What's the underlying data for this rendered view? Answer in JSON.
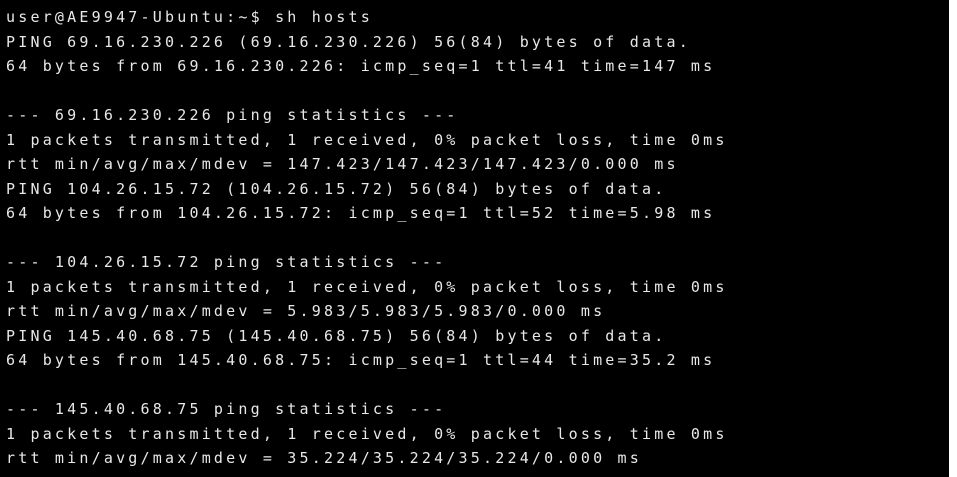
{
  "terminal": {
    "lines": [
      "user@AE9947-Ubuntu:~$ sh hosts",
      "PING 69.16.230.226 (69.16.230.226) 56(84) bytes of data.",
      "64 bytes from 69.16.230.226: icmp_seq=1 ttl=41 time=147 ms",
      "",
      "--- 69.16.230.226 ping statistics ---",
      "1 packets transmitted, 1 received, 0% packet loss, time 0ms",
      "rtt min/avg/max/mdev = 147.423/147.423/147.423/0.000 ms",
      "PING 104.26.15.72 (104.26.15.72) 56(84) bytes of data.",
      "64 bytes from 104.26.15.72: icmp_seq=1 ttl=52 time=5.98 ms",
      "",
      "--- 104.26.15.72 ping statistics ---",
      "1 packets transmitted, 1 received, 0% packet loss, time 0ms",
      "rtt min/avg/max/mdev = 5.983/5.983/5.983/0.000 ms",
      "PING 145.40.68.75 (145.40.68.75) 56(84) bytes of data.",
      "64 bytes from 145.40.68.75: icmp_seq=1 ttl=44 time=35.2 ms",
      "",
      "--- 145.40.68.75 ping statistics ---",
      "1 packets transmitted, 1 received, 0% packet loss, time 0ms",
      "rtt min/avg/max/mdev = 35.224/35.224/35.224/0.000 ms"
    ]
  }
}
